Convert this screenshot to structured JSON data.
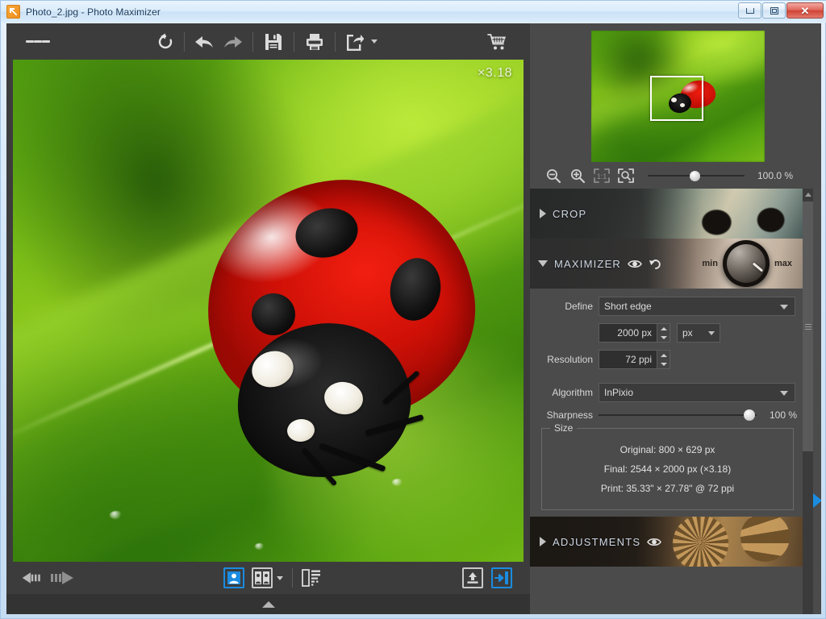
{
  "window": {
    "title": "Photo_2.jpg - Photo Maximizer",
    "app_icon": "maximize-arrows-icon",
    "controls": {
      "minimize": "minimize-icon",
      "maximize": "maximize-icon",
      "close": "✕"
    }
  },
  "toolbar": {
    "menu": "hamburger-menu-icon",
    "reset": "reset-icon",
    "undo": "undo-icon",
    "redo": "redo-icon",
    "save": "save-icon",
    "print": "print-icon",
    "share": "share-export-icon",
    "share_caret": "chevron-down-icon",
    "cart": "shopping-cart-icon"
  },
  "canvas": {
    "zoom_badge": "×3.18"
  },
  "bottombar": {
    "prev": "prev-arrow-icon",
    "next": "next-arrow-icon",
    "single_view": "single-image-view-icon",
    "compare_view": "compare-view-icon",
    "compare_caret": "chevron-down-icon",
    "filmstrip": "filmstrip-toggle-icon",
    "upload": "upload-icon",
    "export": "export-icon",
    "expand": "expand-filmstrip-icon"
  },
  "navigator": {
    "zoom_out": "zoom-out-icon",
    "zoom_in": "zoom-in-icon",
    "actual_size": "one-to-one-icon",
    "fit_screen": "fit-to-screen-icon",
    "zoom_percent": "100.0 %",
    "slider_value": 100
  },
  "sections": {
    "crop": {
      "label": "CROP",
      "expanded": false,
      "arrow": "triangle-right-icon"
    },
    "maximizer": {
      "label": "MAXIMIZER",
      "expanded": true,
      "arrow": "triangle-down-icon",
      "eye": "eye-preview-icon",
      "reset": "reset-icon",
      "knob_min": "min",
      "knob_max": "max"
    },
    "adjustments": {
      "label": "ADJUSTMENTS",
      "expanded": false,
      "arrow": "triangle-right-icon",
      "eye": "eye-preview-icon"
    }
  },
  "maximizer_form": {
    "define_label": "Define",
    "define_value": "Short edge",
    "size_value": "2000 px",
    "unit_value": "px",
    "resolution_label": "Resolution",
    "resolution_value": "72 ppi",
    "algorithm_label": "Algorithm",
    "algorithm_value": "InPixio",
    "sharpness_label": "Sharpness",
    "sharpness_value": "100 %"
  },
  "size_group": {
    "legend": "Size",
    "original": "Original: 800 × 629 px",
    "final": "Final: 2544 × 2000 px (×3.18)",
    "print": "Print: 35.33\" × 27.78\" @ 72 ppi"
  },
  "colors": {
    "accent_blue": "#1b8ce0",
    "panel_bg": "#4b4b4b",
    "toolbar_bg": "#3c3c3c"
  }
}
